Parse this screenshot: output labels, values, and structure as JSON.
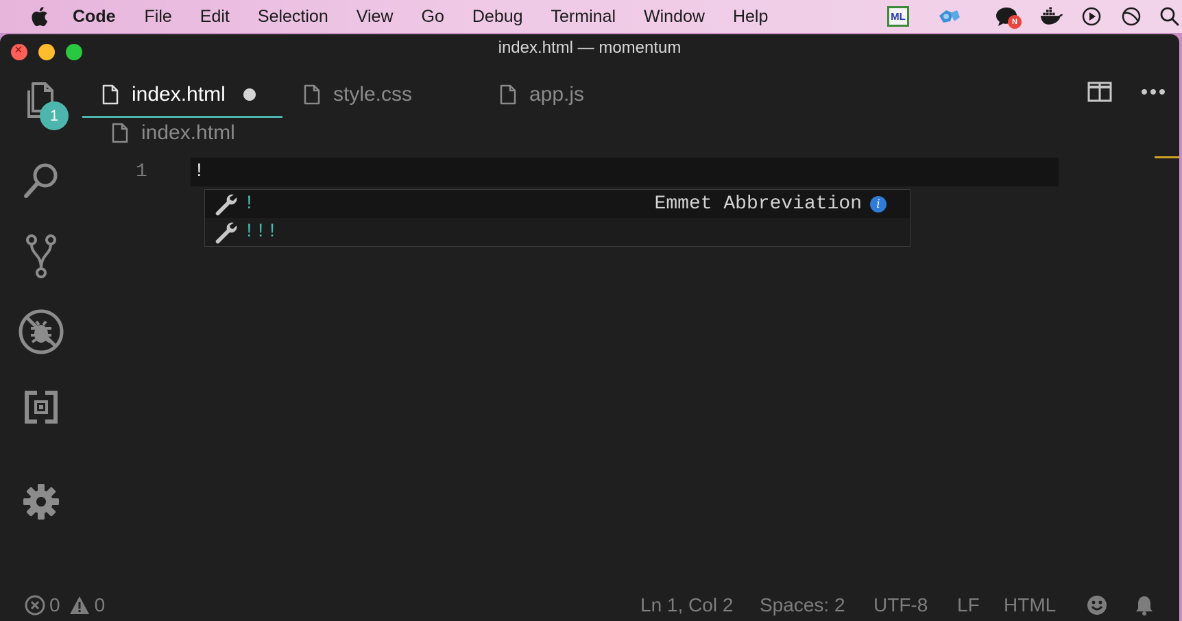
{
  "menubar": {
    "app_name": "Code",
    "items": [
      "File",
      "Edit",
      "Selection",
      "View",
      "Go",
      "Debug",
      "Terminal",
      "Window",
      "Help"
    ],
    "tray": {
      "ml_label": "ML",
      "notification_badge": "N"
    }
  },
  "window": {
    "title": "index.html — momentum"
  },
  "activity_bar": {
    "explorer_badge": "1"
  },
  "tabs": [
    {
      "label": "index.html",
      "active": true,
      "dirty": true
    },
    {
      "label": "style.css",
      "active": false
    },
    {
      "label": "app.js",
      "active": false
    }
  ],
  "breadcrumb": {
    "file": "index.html"
  },
  "editor": {
    "line_number": "1",
    "line_text": "!"
  },
  "suggestions": [
    {
      "label": "!",
      "detail": "Emmet Abbreviation",
      "selected": true
    },
    {
      "label": "!!!",
      "detail": "",
      "selected": false
    }
  ],
  "statusbar": {
    "errors": "0",
    "warnings": "0",
    "position": "Ln 1, Col 2",
    "indentation": "Spaces: 2",
    "encoding": "UTF-8",
    "eol": "LF",
    "language": "HTML"
  },
  "colors": {
    "accent": "#4db6ac",
    "editor_bg": "#1f1f1f",
    "info_blue": "#2f7bd6"
  }
}
